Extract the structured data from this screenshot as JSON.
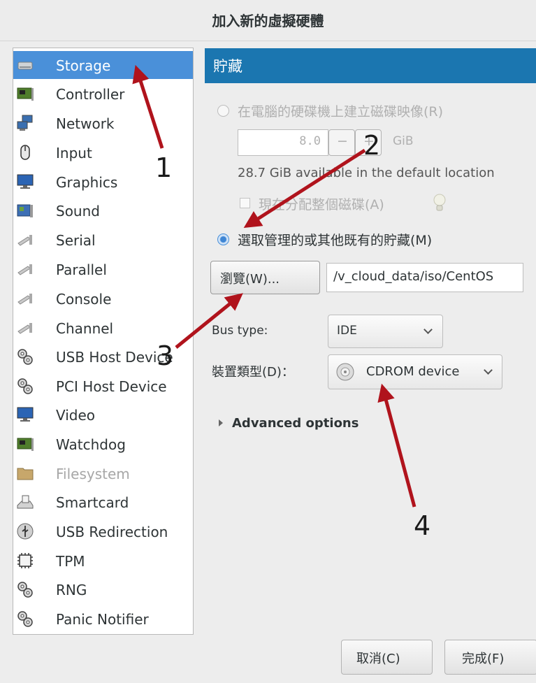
{
  "window": {
    "title": "加入新的虛擬硬體"
  },
  "sidebar": {
    "items": [
      {
        "label": "Storage",
        "icon": "hard-disk-icon"
      },
      {
        "label": "Controller",
        "icon": "controller-card-icon"
      },
      {
        "label": "Network",
        "icon": "network-computers-icon"
      },
      {
        "label": "Input",
        "icon": "mouse-icon"
      },
      {
        "label": "Graphics",
        "icon": "monitor-icon"
      },
      {
        "label": "Sound",
        "icon": "sound-card-icon"
      },
      {
        "label": "Serial",
        "icon": "serial-plug-icon"
      },
      {
        "label": "Parallel",
        "icon": "parallel-plug-icon"
      },
      {
        "label": "Console",
        "icon": "console-plug-icon"
      },
      {
        "label": "Channel",
        "icon": "channel-plug-icon"
      },
      {
        "label": "USB Host Device",
        "icon": "gears-icon"
      },
      {
        "label": "PCI Host Device",
        "icon": "gears-icon"
      },
      {
        "label": "Video",
        "icon": "monitor-icon"
      },
      {
        "label": "Watchdog",
        "icon": "controller-card-icon"
      },
      {
        "label": "Filesystem",
        "icon": "folder-icon"
      },
      {
        "label": "Smartcard",
        "icon": "smartcard-reader-icon"
      },
      {
        "label": "USB Redirection",
        "icon": "usb-icon"
      },
      {
        "label": "TPM",
        "icon": "chip-icon"
      },
      {
        "label": "RNG",
        "icon": "gears-icon"
      },
      {
        "label": "Panic Notifier",
        "icon": "gears-icon"
      }
    ],
    "selected": "Storage"
  },
  "main": {
    "header": "貯藏",
    "create_disk_radio": "在電腦的硬碟機上建立磁碟映像(R)",
    "disk_size": {
      "value": "8.0",
      "minus": "−",
      "plus": "+",
      "unit": "GiB"
    },
    "available_text": "28.7 GiB available in the default location",
    "allocate_checkbox": "現在分配整個磁碟(A)",
    "select_storage_radio": "選取管理的或其他既有的貯藏(M)",
    "browse_button": "瀏覽(W)...",
    "path_value": "/v_cloud_data/iso/CentOS",
    "bus_type_label": "Bus type:",
    "bus_type_value": "IDE",
    "device_type_label": "裝置類型(D)：",
    "device_type_value": "CDROM device",
    "advanced_options": "Advanced options"
  },
  "footer": {
    "cancel": "取消(C)",
    "finish": "完成(F)"
  },
  "annotations": {
    "n1": "1",
    "n2": "2",
    "n3": "3",
    "n4": "4",
    "arrow_color": "#b0131c"
  },
  "colors": {
    "selection": "#4a90d9",
    "header": "#1b76b0"
  }
}
